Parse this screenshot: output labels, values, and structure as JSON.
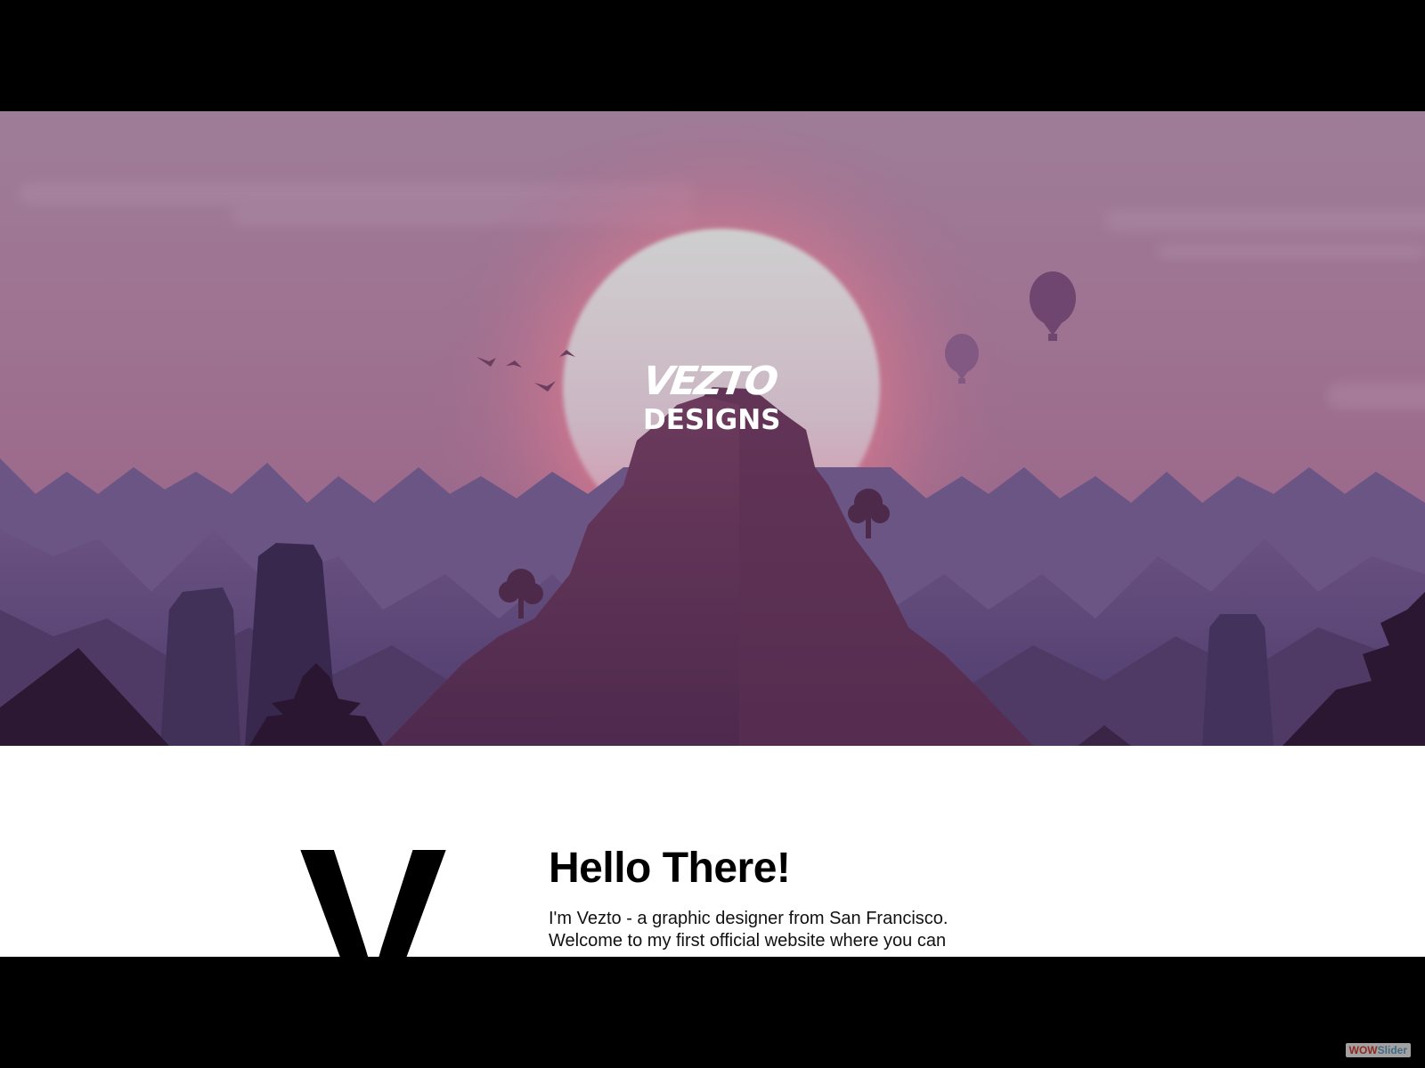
{
  "hero": {
    "logo_wordmark": "VEZTO",
    "logo_subtitle": "DESIGNS"
  },
  "about": {
    "big_letter": "V",
    "title": "Hello There!",
    "intro_line_1": "I'm Vezto - a graphic designer from San Francisco.",
    "intro_line_2": "Welcome to my first official website where you can"
  },
  "badge": {
    "wow": "WOW",
    "slider": "Slider"
  },
  "colors": {
    "sky_top": "#9e7b98",
    "sky_bottom": "#9a6488",
    "sun": "#cbcbcb",
    "glow": "#e07a8c",
    "mountain_far": "#5e4a7a",
    "mountain_peak": "#6f3a5c",
    "foreground": "#2e1a36",
    "page_background": "#ffffff"
  }
}
